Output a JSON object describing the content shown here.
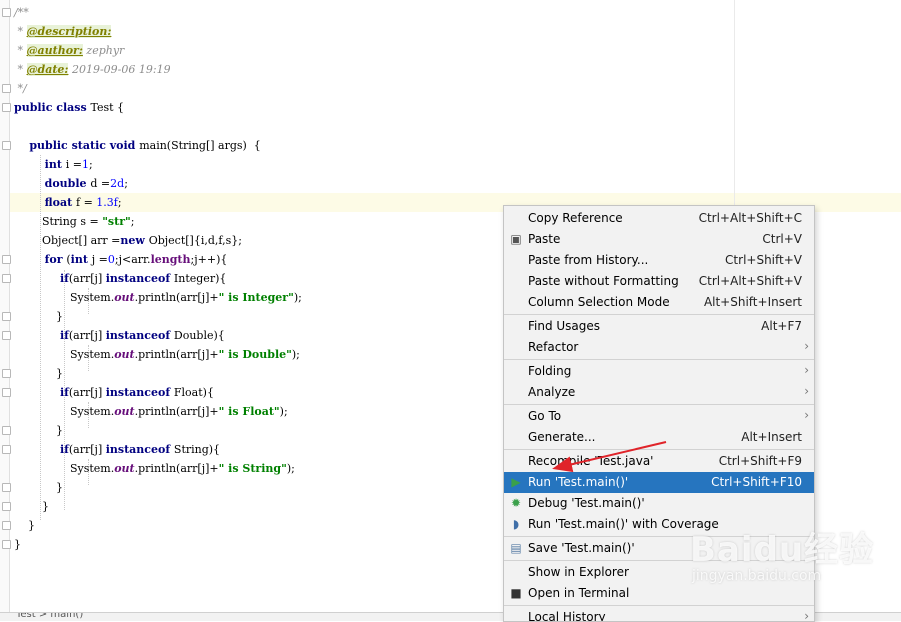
{
  "editor": {
    "lines": [
      [
        {
          "t": "/**",
          "c": "cm"
        }
      ],
      [
        {
          "t": " * ",
          "c": "cm"
        },
        {
          "t": "@description:",
          "c": "tag"
        }
      ],
      [
        {
          "t": " * ",
          "c": "cm"
        },
        {
          "t": "@author:",
          "c": "tag"
        },
        {
          "t": " zephyr",
          "c": "cm"
        }
      ],
      [
        {
          "t": " * ",
          "c": "cm"
        },
        {
          "t": "@date:",
          "c": "tag"
        },
        {
          "t": " 2019-09-06 19:19",
          "c": "cm"
        }
      ],
      [
        {
          "t": " */",
          "c": "cm"
        }
      ],
      [
        {
          "t": "public class ",
          "c": "kw"
        },
        {
          "t": "Test {",
          "c": ""
        }
      ],
      [],
      [
        {
          "t": "    public static void ",
          "c": "kw"
        },
        {
          "t": "main(String[] args)  {",
          "c": ""
        }
      ],
      [
        {
          "t": "        int ",
          "c": "kw"
        },
        {
          "t": "i =",
          "c": ""
        },
        {
          "t": "1",
          "c": "num"
        },
        {
          "t": ";",
          "c": ""
        }
      ],
      [
        {
          "t": "        double ",
          "c": "kw"
        },
        {
          "t": "d =",
          "c": ""
        },
        {
          "t": "2d",
          "c": "num"
        },
        {
          "t": ";",
          "c": ""
        }
      ],
      [
        {
          "t": "        float ",
          "c": "kw"
        },
        {
          "t": "f = ",
          "c": ""
        },
        {
          "t": "1.3f",
          "c": "num"
        },
        {
          "t": ";",
          "c": ""
        }
      ],
      [
        {
          "t": "        String s = ",
          "c": ""
        },
        {
          "t": "\"str\"",
          "c": "str"
        },
        {
          "t": ";",
          "c": ""
        }
      ],
      [
        {
          "t": "        Object[] arr =",
          "c": ""
        },
        {
          "t": "new ",
          "c": "kw"
        },
        {
          "t": "Object[]{i,d,f,s};",
          "c": ""
        }
      ],
      [
        {
          "t": "        for ",
          "c": "kw"
        },
        {
          "t": "(",
          "c": ""
        },
        {
          "t": "int ",
          "c": "kw"
        },
        {
          "t": "j =",
          "c": ""
        },
        {
          "t": "0",
          "c": "num"
        },
        {
          "t": ";j<arr.",
          "c": ""
        },
        {
          "t": "length",
          "c": "fld2"
        },
        {
          "t": ";j++){",
          "c": ""
        }
      ],
      [
        {
          "t": "            if",
          "c": "kw"
        },
        {
          "t": "(arr[j] ",
          "c": ""
        },
        {
          "t": "instanceof ",
          "c": "kw"
        },
        {
          "t": "Integer){",
          "c": ""
        }
      ],
      [
        {
          "t": "                System.",
          "c": ""
        },
        {
          "t": "out",
          "c": "fld"
        },
        {
          "t": ".println(arr[j]+",
          "c": ""
        },
        {
          "t": "\" is Integer\"",
          "c": "str"
        },
        {
          "t": ");",
          "c": ""
        }
      ],
      [
        {
          "t": "            }",
          "c": ""
        }
      ],
      [
        {
          "t": "            if",
          "c": "kw"
        },
        {
          "t": "(arr[j] ",
          "c": ""
        },
        {
          "t": "instanceof ",
          "c": "kw"
        },
        {
          "t": "Double){",
          "c": ""
        }
      ],
      [
        {
          "t": "                System.",
          "c": ""
        },
        {
          "t": "out",
          "c": "fld"
        },
        {
          "t": ".println(arr[j]+",
          "c": ""
        },
        {
          "t": "\" is Double\"",
          "c": "str"
        },
        {
          "t": ");",
          "c": ""
        }
      ],
      [
        {
          "t": "            }",
          "c": ""
        }
      ],
      [
        {
          "t": "            if",
          "c": "kw"
        },
        {
          "t": "(arr[j] ",
          "c": ""
        },
        {
          "t": "instanceof ",
          "c": "kw"
        },
        {
          "t": "Float){",
          "c": ""
        }
      ],
      [
        {
          "t": "                System.",
          "c": ""
        },
        {
          "t": "out",
          "c": "fld"
        },
        {
          "t": ".println(arr[j]+",
          "c": ""
        },
        {
          "t": "\" is Float\"",
          "c": "str"
        },
        {
          "t": ");",
          "c": ""
        }
      ],
      [
        {
          "t": "            }",
          "c": ""
        }
      ],
      [
        {
          "t": "            if",
          "c": "kw"
        },
        {
          "t": "(arr[j] ",
          "c": ""
        },
        {
          "t": "instanceof ",
          "c": "kw"
        },
        {
          "t": "String){",
          "c": ""
        }
      ],
      [
        {
          "t": "                System.",
          "c": ""
        },
        {
          "t": "out",
          "c": "fld"
        },
        {
          "t": ".println(arr[j]+",
          "c": ""
        },
        {
          "t": "\" is String\"",
          "c": "str"
        },
        {
          "t": ");",
          "c": ""
        }
      ],
      [
        {
          "t": "            }",
          "c": ""
        }
      ],
      [
        {
          "t": "        }",
          "c": ""
        }
      ],
      [
        {
          "t": "    }",
          "c": ""
        }
      ],
      [
        {
          "t": "}",
          "c": ""
        }
      ]
    ],
    "status_text": "Test > main()"
  },
  "context_menu": {
    "groups": [
      [
        {
          "label": "Copy Reference",
          "shortcut": "Ctrl+Alt+Shift+C",
          "icon": "",
          "name": "copy-reference"
        },
        {
          "label": "Paste",
          "shortcut": "Ctrl+V",
          "icon": "clipboard-icon",
          "name": "paste"
        },
        {
          "label": "Paste from History...",
          "shortcut": "Ctrl+Shift+V",
          "icon": "",
          "name": "paste-from-history"
        },
        {
          "label": "Paste without Formatting",
          "shortcut": "Ctrl+Alt+Shift+V",
          "icon": "",
          "name": "paste-without-formatting"
        },
        {
          "label": "Column Selection Mode",
          "shortcut": "Alt+Shift+Insert",
          "icon": "",
          "name": "column-selection-mode"
        }
      ],
      [
        {
          "label": "Find Usages",
          "shortcut": "Alt+F7",
          "icon": "",
          "name": "find-usages"
        },
        {
          "label": "Refactor",
          "submenu": true,
          "icon": "",
          "name": "refactor"
        }
      ],
      [
        {
          "label": "Folding",
          "submenu": true,
          "icon": "",
          "name": "folding"
        },
        {
          "label": "Analyze",
          "submenu": true,
          "icon": "",
          "name": "analyze"
        }
      ],
      [
        {
          "label": "Go To",
          "submenu": true,
          "icon": "",
          "name": "go-to"
        },
        {
          "label": "Generate...",
          "shortcut": "Alt+Insert",
          "icon": "",
          "name": "generate"
        }
      ],
      [
        {
          "label": "Recompile 'Test.java'",
          "shortcut": "Ctrl+Shift+F9",
          "icon": "",
          "name": "recompile"
        },
        {
          "label": "Run 'Test.main()'",
          "shortcut": "Ctrl+Shift+F10",
          "icon": "run-icon",
          "name": "run",
          "selected": true
        },
        {
          "label": "Debug 'Test.main()'",
          "icon": "debug-icon",
          "name": "debug"
        },
        {
          "label": "Run 'Test.main()' with Coverage",
          "icon": "coverage-icon",
          "name": "run-with-coverage"
        }
      ],
      [
        {
          "label": "Save 'Test.main()'",
          "icon": "save-config-icon",
          "name": "save-config"
        }
      ],
      [
        {
          "label": "Show in Explorer",
          "icon": "",
          "name": "show-in-explorer"
        },
        {
          "label": "Open in Terminal",
          "icon": "terminal-icon",
          "name": "open-in-terminal"
        }
      ],
      [
        {
          "label": "Local History",
          "submenu": true,
          "icon": "",
          "name": "local-history"
        }
      ]
    ]
  },
  "watermark": {
    "brand": "Baidu经验",
    "url": "jingyan.baidu.com"
  },
  "colors": {
    "selection": "#2675bf",
    "annotation_arrow": "#e0242a",
    "keyword": "#000080",
    "string": "#008000",
    "comment": "#8c8c8c"
  }
}
